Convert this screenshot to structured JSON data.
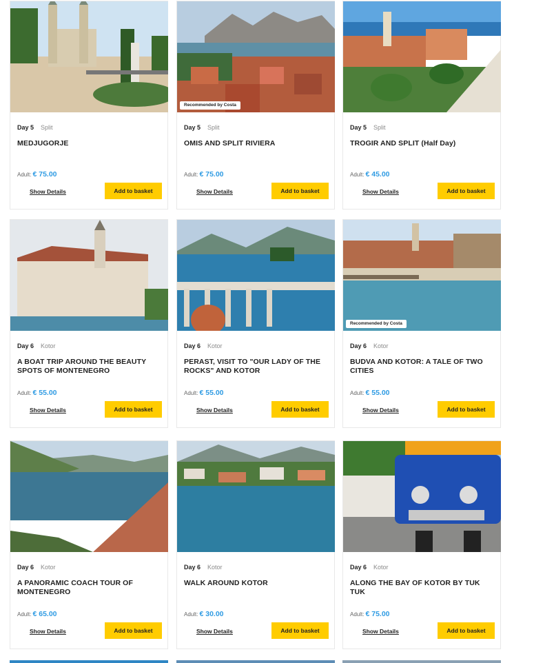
{
  "cards": [
    {
      "day": "Day 5",
      "city": "Split",
      "title": "MEDJUGORJE",
      "price_label": "Adult:",
      "price": "€ 75.00",
      "details": "Show Details",
      "basket": "Add to basket",
      "badge": ""
    },
    {
      "day": "Day 5",
      "city": "Split",
      "title": "OMIS AND SPLIT RIVIERA",
      "price_label": "Adult:",
      "price": "€ 75.00",
      "details": "Show Details",
      "basket": "Add to basket",
      "badge": "Recommended by Costa"
    },
    {
      "day": "Day 5",
      "city": "Split",
      "title": "TROGIR AND SPLIT (Half Day)",
      "price_label": "Adult:",
      "price": "€ 45.00",
      "details": "Show Details",
      "basket": "Add to basket",
      "badge": ""
    },
    {
      "day": "Day 6",
      "city": "Kotor",
      "title": "A BOAT TRIP AROUND THE BEAUTY SPOTS OF MONTENEGRO",
      "price_label": "Adult:",
      "price": "€ 55.00",
      "details": "Show Details",
      "basket": "Add to basket",
      "badge": ""
    },
    {
      "day": "Day 6",
      "city": "Kotor",
      "title": "PERAST, VISIT TO \"OUR LADY OF THE ROCKS\" AND KOTOR",
      "price_label": "Adult:",
      "price": "€ 55.00",
      "details": "Show Details",
      "basket": "Add to basket",
      "badge": ""
    },
    {
      "day": "Day 6",
      "city": "Kotor",
      "title": "BUDVA AND KOTOR: A TALE OF TWO CITIES",
      "price_label": "Adult:",
      "price": "€ 55.00",
      "details": "Show Details",
      "basket": "Add to basket",
      "badge": "Recommended by Costa"
    },
    {
      "day": "Day 6",
      "city": "Kotor",
      "title": "A PANORAMIC COACH TOUR OF MONTENEGRO",
      "price_label": "Adult:",
      "price": "€ 65.00",
      "details": "Show Details",
      "basket": "Add to basket",
      "badge": ""
    },
    {
      "day": "Day 6",
      "city": "Kotor",
      "title": "WALK AROUND KOTOR",
      "price_label": "Adult:",
      "price": "€ 30.00",
      "details": "Show Details",
      "basket": "Add to basket",
      "badge": ""
    },
    {
      "day": "Day 6",
      "city": "Kotor",
      "title": "ALONG THE BAY OF KOTOR BY TUK TUK",
      "price_label": "Adult:",
      "price": "€ 75.00",
      "details": "Show Details",
      "basket": "Add to basket",
      "badge": ""
    }
  ],
  "colors": {
    "accent_button": "#ffcc00",
    "price": "#2f9be3",
    "muted": "#8a8a8a"
  }
}
